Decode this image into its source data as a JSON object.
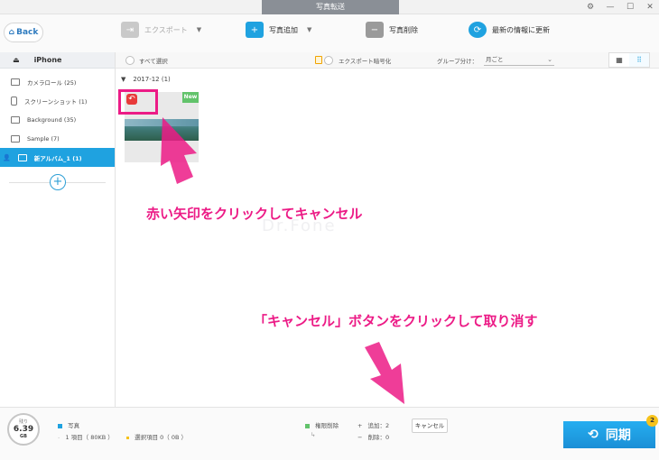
{
  "window": {
    "title": "写真転送"
  },
  "toolbar": {
    "back_label": "Back",
    "export_label": "エクスポート",
    "add_label": "写真追加",
    "delete_label": "写真削除",
    "refresh_label": "最新の情報に更新"
  },
  "sidebar": {
    "device": "iPhone",
    "items": [
      {
        "label": "カメラロール (25)",
        "icon": "camera-icon"
      },
      {
        "label": "スクリーンショット (1)",
        "icon": "phone-icon"
      },
      {
        "label": "Background (35)",
        "icon": "album-icon"
      },
      {
        "label": "Sample (7)",
        "icon": "album-icon"
      },
      {
        "label": "新アルバム_1 (1)",
        "icon": "album-icon",
        "active": true
      }
    ]
  },
  "content_header": {
    "select_all": "すべて選択",
    "export_encrypt": "エクスポート暗号化",
    "group_by_label": "グループ分け：",
    "group_by_value": "月ごと"
  },
  "photos": {
    "group_title": "2017-12 (1)",
    "badge": "New"
  },
  "annotations": {
    "text1": "赤い矢印をクリックしてキャンセル",
    "text2": "「キャンセル」ボタンをクリックして取り消す",
    "watermark": "Dr.Fone"
  },
  "footer": {
    "storage_top": "残り",
    "storage_value": "6.39",
    "storage_unit": "GB",
    "category": "写真",
    "items_count": "1 項目（ 80KB ）",
    "selected": "選択項目 0（ 0B ）",
    "limit_delete": "権限削除",
    "added": "追加：2",
    "deleted": "削除：0",
    "cancel_label": "キャンセル",
    "sync_label": "同期",
    "sync_badge": "2"
  },
  "colors": {
    "accent": "#1fa2e0",
    "annotation": "#ec1b86",
    "new_badge": "#62c36b",
    "sync": "#1b8fd6"
  }
}
